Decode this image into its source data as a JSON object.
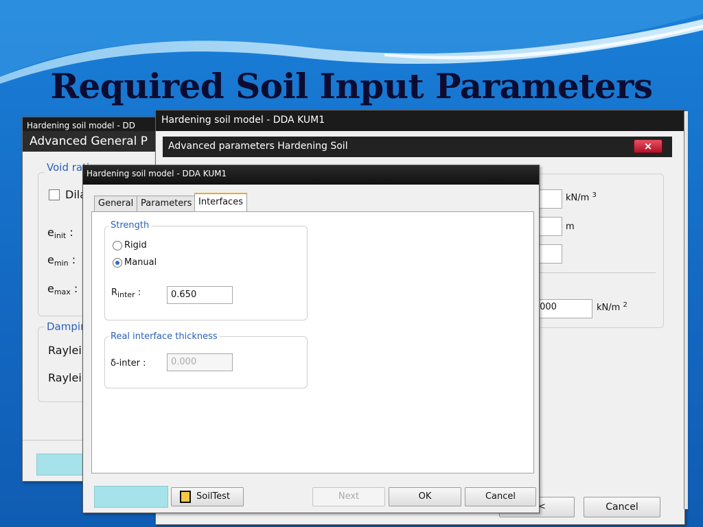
{
  "slide": {
    "title": "Required Soil Input Parameters"
  },
  "colors": {
    "slide_bg": "#1469c2",
    "title_bar": "#1b1b1b",
    "accent_tab": "#f2a81d",
    "legend_text": "#2a5fb8",
    "close_button": "#c8102e",
    "cyan_button": "#a6e2ea"
  },
  "back_window": {
    "title": "Hardening soil model - DD",
    "subtitle": "Advanced General P",
    "void_ratio_group": "Void ratio",
    "dilatancy_label": "Dila",
    "e_init": {
      "base": "e",
      "sub": "init",
      "suffix": ":"
    },
    "e_min": {
      "base": "e",
      "sub": "min",
      "suffix": ":"
    },
    "e_max": {
      "base": "e",
      "sub": "max",
      "suffix": ":"
    },
    "damping_group": "Dampir",
    "rayleigh_1": "Raylei",
    "rayleigh_2": "Raylei"
  },
  "middle_window": {
    "title": "Hardening soil model - DDA KUM1",
    "subtitle": "Advanced parameters Hardening Soil",
    "close_icon": "×",
    "unit_1": {
      "base": "kN/m",
      "sup": "3"
    },
    "unit_2": "m",
    "unit_3": {
      "base": "kN/m",
      "sup": "2"
    },
    "value_3": ".000",
    "cancel_label": "Cancel",
    "back_fragment": "<"
  },
  "front_window": {
    "title": "Hardening soil model - DDA KUM1",
    "tabs": [
      {
        "label": "General",
        "active": false
      },
      {
        "label": "Parameters",
        "active": false
      },
      {
        "label": "Interfaces",
        "active": true
      }
    ],
    "strength_group": {
      "legend": "Strength",
      "options": [
        {
          "label": "Rigid",
          "checked": false
        },
        {
          "label": "Manual",
          "checked": true
        }
      ],
      "r_inter": {
        "base": "R",
        "sub": "inter",
        "suffix": ":"
      },
      "r_inter_value": "0.650"
    },
    "thickness_group": {
      "legend": "Real interface thickness",
      "label": "δ-inter :",
      "value": "0.000"
    },
    "footer": {
      "soiltest_label": "SoilTest",
      "next_label": "Next",
      "ok_label": "OK",
      "cancel_label": "Cancel"
    }
  }
}
